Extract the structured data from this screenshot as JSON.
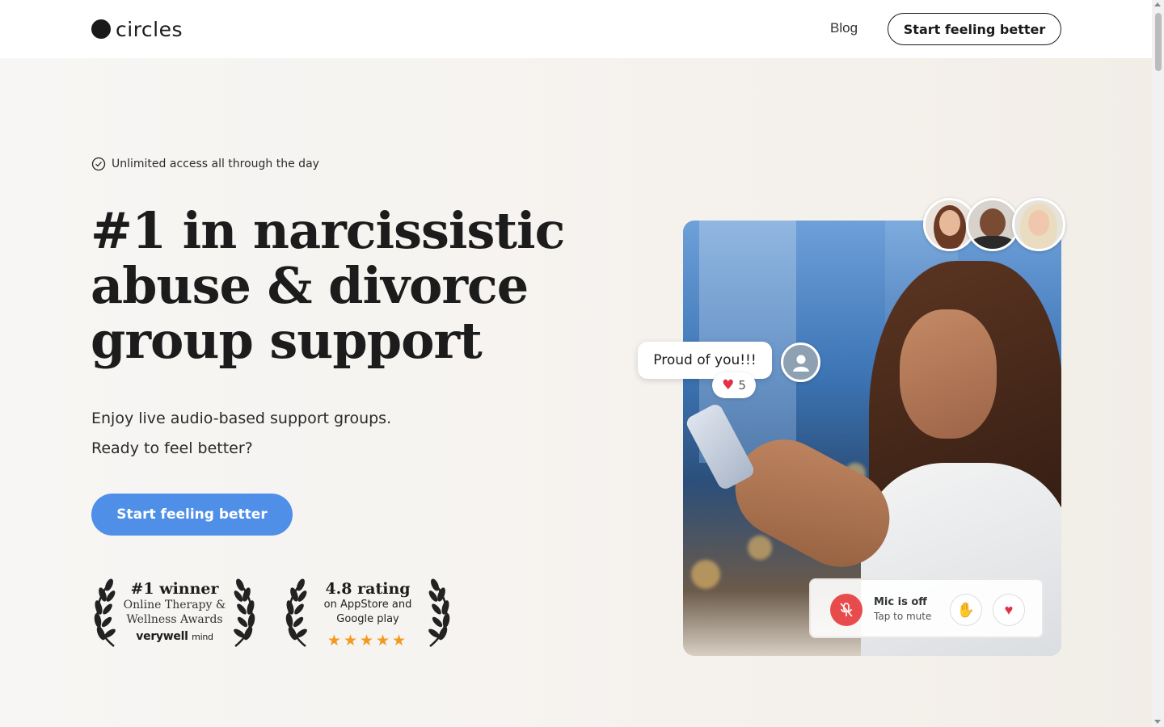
{
  "header": {
    "logo_text": "circles",
    "nav_blog": "Blog",
    "cta_label": "Start feeling better"
  },
  "hero": {
    "badge_text": "Unlimited access all through the day",
    "headline_line1": "#1 in narcissistic",
    "headline_line2": "abuse & divorce",
    "headline_line3": "group support",
    "sub_line1": "Enjoy live audio-based support groups.",
    "sub_line2": "Ready to feel better?",
    "cta_label": "Start feeling better"
  },
  "awards": [
    {
      "title": "#1 winner",
      "line1": "Online Therapy &",
      "line2": "Wellness Awards",
      "brand_bold": "verywell",
      "brand_light": "mind"
    },
    {
      "title": "4.8 rating",
      "line1": "on AppStore and",
      "line2": "Google play",
      "stars": "★★★★★",
      "star_rating": 5
    }
  ],
  "chat": {
    "bubble_text": "Proud of you!!!",
    "reaction_emoji": "♥",
    "reaction_count": "5"
  },
  "mic_panel": {
    "title": "Mic is off",
    "subtitle": "Tap to mute",
    "hand_icon": "✋",
    "heart_icon": "♥"
  },
  "colors": {
    "accent": "#4f8fe8",
    "mic_off": "#e84b4b",
    "star": "#f29a1f",
    "heart": "#e33049"
  }
}
